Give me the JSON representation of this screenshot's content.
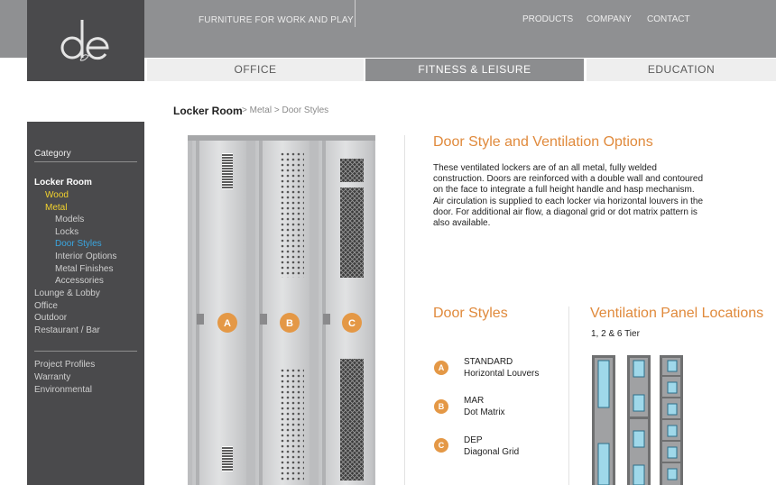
{
  "header": {
    "logo_text": "d&e",
    "tagline": "FURNITURE FOR WORK AND PLAY",
    "nav": [
      "PRODUCTS",
      "COMPANY",
      "CONTACT"
    ]
  },
  "tabs": [
    {
      "label": "OFFICE",
      "active": false
    },
    {
      "label": "FITNESS & LEISURE",
      "active": true
    },
    {
      "label": "EDUCATION",
      "active": false
    }
  ],
  "breadcrumb": {
    "current": "Locker Room",
    "rest": "> Metal > Door Styles"
  },
  "sidebar": {
    "title": "Category",
    "items": [
      {
        "label": "Locker Room",
        "level": 0,
        "state": "top"
      },
      {
        "label": "Wood",
        "level": 1,
        "state": "yellow"
      },
      {
        "label": "Metal",
        "level": 1,
        "state": "yellow"
      },
      {
        "label": "Models",
        "level": 2,
        "state": "normal"
      },
      {
        "label": "Locks",
        "level": 2,
        "state": "normal"
      },
      {
        "label": "Door Styles",
        "level": 2,
        "state": "current"
      },
      {
        "label": "Interior Options",
        "level": 2,
        "state": "normal"
      },
      {
        "label": "Metal Finishes",
        "level": 2,
        "state": "normal"
      },
      {
        "label": "Accessories",
        "level": 2,
        "state": "normal"
      },
      {
        "label": "Lounge & Lobby",
        "level": 0,
        "state": "normal"
      },
      {
        "label": "Office",
        "level": 0,
        "state": "normal"
      },
      {
        "label": "Outdoor",
        "level": 0,
        "state": "normal"
      },
      {
        "label": "Restaurant / Bar",
        "level": 0,
        "state": "normal"
      }
    ],
    "links": [
      "Project Profiles",
      "Warranty",
      "Environmental"
    ]
  },
  "content": {
    "heading": "Door Style and Ventilation Options",
    "description": "These ventilated lockers are of an all metal, fully welded construction. Doors are reinforced with a double wall and contoured on the face to integrate a full height handle and hasp mechanism. Air circulation is supplied to each locker via horizontal louvers in the door. For additional air flow, a diagonal grid or dot matrix pattern is also available.",
    "door_styles_heading": "Door Styles",
    "ventilation_heading": "Ventilation Panel Locations",
    "tier_label": "1, 2 & 6 Tier",
    "door_styles": [
      {
        "badge": "A",
        "code": "STANDARD",
        "name": "Horizontal Louvers"
      },
      {
        "badge": "B",
        "code": "MAR",
        "name": "Dot Matrix"
      },
      {
        "badge": "C",
        "code": "DEP",
        "name": "Diagonal Grid"
      }
    ],
    "locker_badges": [
      "A",
      "B",
      "C"
    ]
  },
  "colors": {
    "accent_orange": "#e08a3c",
    "header_gray": "#8f9092",
    "sidebar_dark": "#4a4a4c",
    "current_blue": "#3aa6e0",
    "parent_yellow": "#f2d22e"
  }
}
